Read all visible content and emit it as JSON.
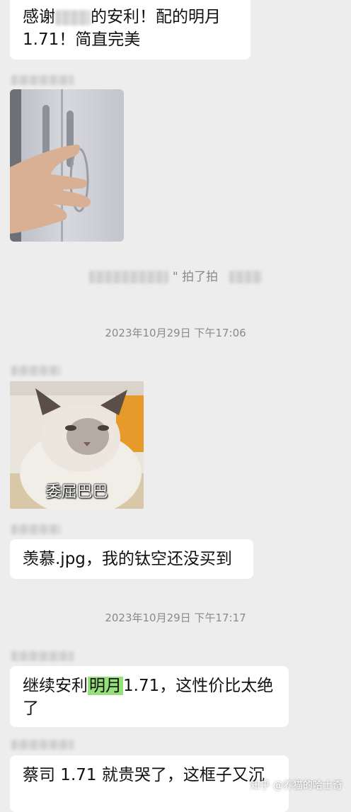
{
  "messages": {
    "m1": {
      "line1_pre": "感谢",
      "line1_post": "的安利！配的明月",
      "line2": "1.71！简直完美"
    },
    "system_pat": {
      "text": "\" 拍了拍"
    },
    "ts1": "2023年10月29日 下午17:06",
    "cat_caption": "委屈巴巴",
    "m2": "羡慕.jpg，我的钛空还没买到",
    "ts2": "2023年10月29日 下午17:17",
    "m3": {
      "pre": "继续安利",
      "highlight": "明月",
      "post": "1.71，这性价比太绝",
      "line2": "了"
    },
    "m4": "蔡司 1.71 就贵哭了，这框子又沉"
  },
  "watermark": "知乎 @养猫的哈士奇",
  "colors": {
    "background": "#ededed",
    "bubble": "#ffffff",
    "highlight": "#95e07a",
    "timestamp": "#8a8a8a"
  }
}
